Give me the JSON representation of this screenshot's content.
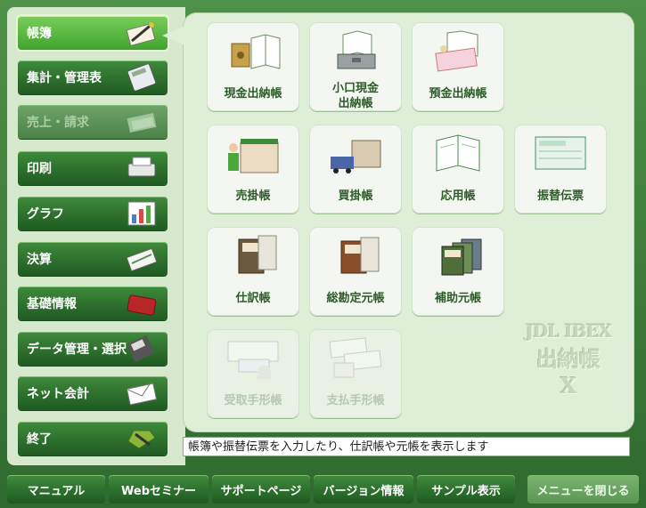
{
  "sidebar": {
    "items": [
      {
        "label": "帳簿",
        "icon": "pen-notebook-icon"
      },
      {
        "label": "集計・管理表",
        "icon": "calculator-icon"
      },
      {
        "label": "売上・請求",
        "icon": "invoice-icon"
      },
      {
        "label": "印刷",
        "icon": "printer-icon"
      },
      {
        "label": "グラフ",
        "icon": "bar-chart-icon"
      },
      {
        "label": "決算",
        "icon": "report-book-icon"
      },
      {
        "label": "基礎情報",
        "icon": "briefcase-icon"
      },
      {
        "label": "データ管理・選択",
        "icon": "floppy-disk-icon"
      },
      {
        "label": "ネット会計",
        "icon": "envelope-icon"
      },
      {
        "label": "終了",
        "icon": "exit-icon"
      }
    ]
  },
  "tiles": [
    {
      "label": "現金出納帳",
      "icon": "safe-ledger-icon"
    },
    {
      "label": "小口現金\n出納帳",
      "icon": "cashbox-ledger-icon"
    },
    {
      "label": "預金出納帳",
      "icon": "bankbook-ledger-icon"
    },
    {
      "label": "売掛帳",
      "icon": "company-store-icon"
    },
    {
      "label": "買掛帳",
      "icon": "warehouse-truck-icon"
    },
    {
      "label": "応用帳",
      "icon": "open-ledger-icon"
    },
    {
      "label": "振替伝票",
      "icon": "transfer-slip-icon"
    },
    {
      "label": "仕訳帳",
      "icon": "journal-book-icon"
    },
    {
      "label": "総勘定元帳",
      "icon": "general-ledger-icon"
    },
    {
      "label": "補助元帳",
      "icon": "subsidiary-ledger-icon"
    },
    {
      "label": "受取手形帳",
      "icon": "promissory-note-receive-icon"
    },
    {
      "label": "支払手形帳",
      "icon": "promissory-note-pay-icon"
    }
  ],
  "watermark": {
    "line1": "JDL IBEX",
    "line2": "出納帳",
    "line3": "X"
  },
  "status": "帳簿や振替伝票を入力したり、仕訳帳や元帳を表示します",
  "bottom": {
    "manual": "マニュアル",
    "web_seminar": "Webセミナー",
    "support": "サポートページ",
    "version": "バージョン情報",
    "sample": "サンプル表示",
    "close": "メニューを閉じる"
  },
  "colors": {
    "accent": "#4aa83a",
    "frame": "#3c7a3a",
    "panel": "#dfeed6"
  }
}
